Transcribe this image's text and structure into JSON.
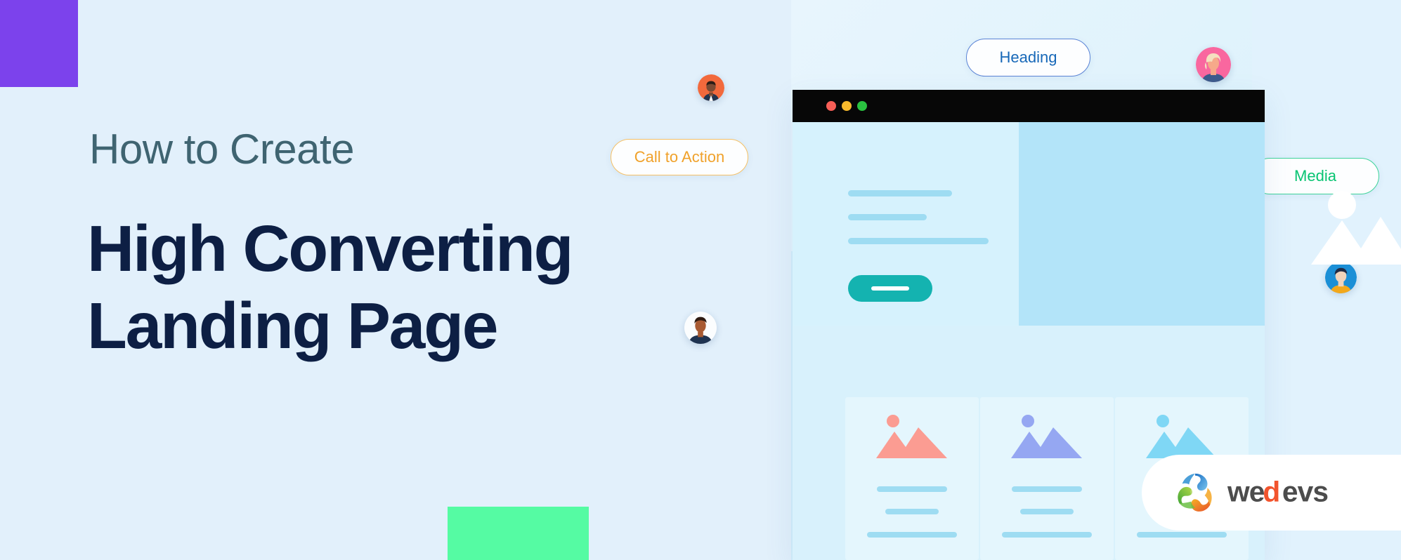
{
  "page": {
    "background_color": "#e2f0fb",
    "kicker": "How to Create",
    "headline": "High Converting\nLanding Page",
    "headline_color": "#0d1f44",
    "kicker_color": "#3f6471"
  },
  "decor": {
    "square_purple": {
      "name": "purple-square",
      "color": "#7c42ec"
    },
    "square_blue": {
      "name": "blue-square",
      "color": "#21a3f7"
    },
    "square_green": {
      "name": "green-square",
      "color": "#55fba3"
    }
  },
  "badges": [
    {
      "id": "cta",
      "label": "Call to Action",
      "text_color": "#f0a12a",
      "border_color": "#f5c066"
    },
    {
      "id": "heading",
      "label": "Heading",
      "text_color": "#1768b8",
      "border_color": "#5b84d6"
    },
    {
      "id": "media",
      "label": "Media",
      "text_color": "#08c472",
      "border_color": "#3ed39a"
    }
  ],
  "avatars": [
    {
      "id": "avatar-1",
      "icon": "user-avatar-orange",
      "bg": "#f2693c",
      "skin": "#7a4a33",
      "hair": "#2b1d16",
      "shirt": "#24354f"
    },
    {
      "id": "avatar-2",
      "icon": "user-avatar-white",
      "bg": "#fbfdfe",
      "skin": "#a85a32",
      "hair": "#2e1b12",
      "shirt": "#1f3350"
    },
    {
      "id": "avatar-3",
      "icon": "user-avatar-pink",
      "bg": "#f9679f",
      "skin": "#f6a98a",
      "hair": "#f4e0c0",
      "shirt": "#3d5b8c"
    },
    {
      "id": "avatar-4",
      "icon": "user-avatar-blue",
      "bg": "#1b8fd6",
      "skin": "#f0d3bb",
      "hair": "#1f2b45",
      "shirt": "#f2a81c"
    }
  ],
  "browser": {
    "titlebar_color": "#070707",
    "traffic_lights": [
      {
        "name": "close-dot",
        "color": "#f65e56"
      },
      {
        "name": "minimize-dot",
        "color": "#f7b92c"
      },
      {
        "name": "maximize-dot",
        "color": "#2ac140"
      }
    ],
    "hero": {
      "left_bg": "#d6f2fd",
      "right_bg": "#b3e4f9",
      "text_bars": 3,
      "button_color": "#14b3b0",
      "image_icon": "mountain-placeholder-icon",
      "image_icon_color": "#ffffff"
    },
    "cards": [
      {
        "id": "card-1",
        "icon": "mountain-placeholder-icon",
        "icon_color": "#fb9c92",
        "bars": 3
      },
      {
        "id": "card-2",
        "icon": "mountain-placeholder-icon",
        "icon_color": "#95a7f2",
        "bars": 3
      },
      {
        "id": "card-3",
        "icon": "mountain-placeholder-icon",
        "icon_color": "#7fd7f5",
        "bars": 3
      }
    ],
    "bar_color": "#9edcf2",
    "card_bg": "#e4f6fd"
  },
  "logo": {
    "wordmark": "wedevs",
    "mark_name": "wedevs-trefoil-logo-icon",
    "word_color": "#4c4c4c",
    "accent_color": "#f2542d",
    "mark_colors": {
      "blue": "#1c7fd0",
      "green": "#6cbf45",
      "orange": "#f5a623",
      "red": "#e8502e"
    }
  }
}
